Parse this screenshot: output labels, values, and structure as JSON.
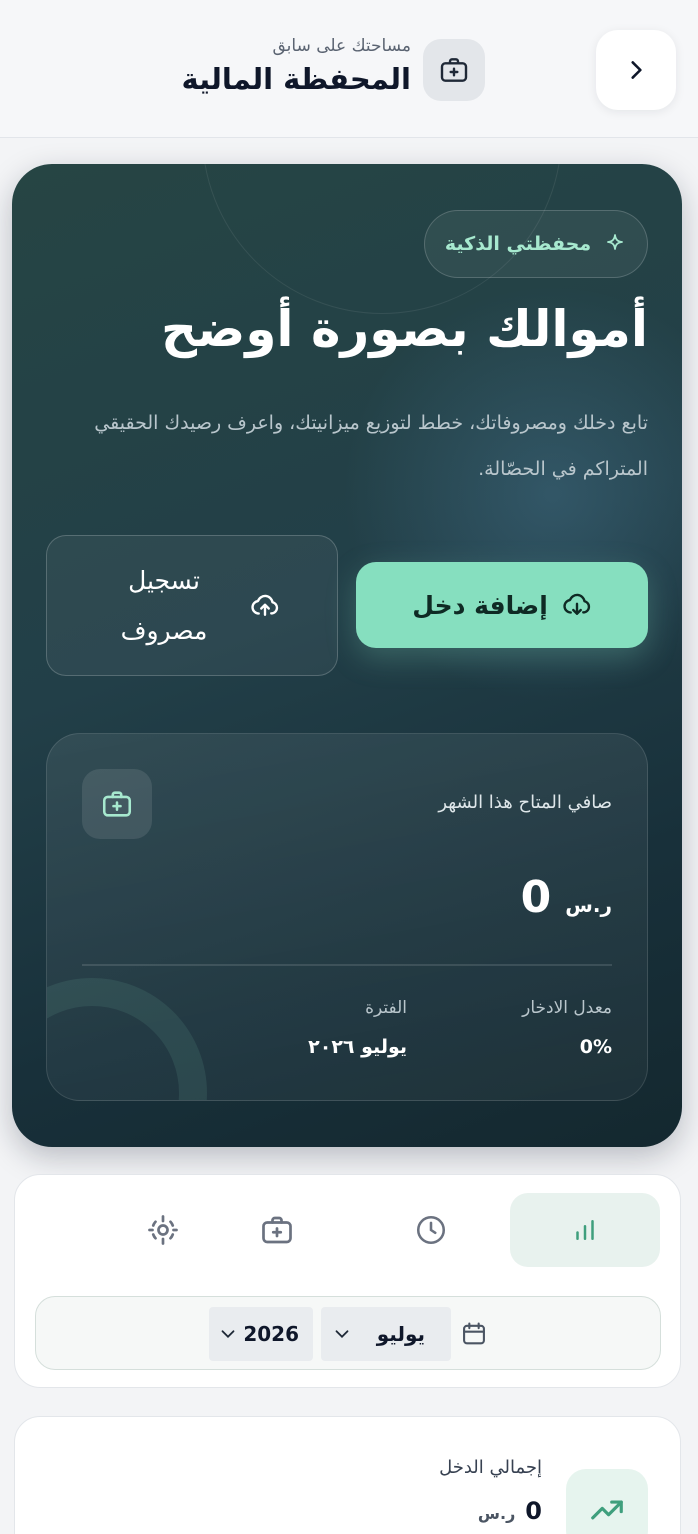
{
  "header": {
    "subtitle": "مساحتك على سابق",
    "title": "المحفظة المالية",
    "back_icon": "chevron-right-icon",
    "wallet_icon": "wallet-icon"
  },
  "hero": {
    "badge": "محفظتي الذكية",
    "title": "أموالك بصورة أوضح",
    "description": "تابع دخلك ومصروفاتك، خطط لتوزيع ميزانيتك، واعرف رصيدك الحقيقي المتراكم في الحصّالة.",
    "add_income_label": "إضافة دخل",
    "log_expense_label": "تسجيل مصروف",
    "net": {
      "label": "صافي المتاح هذا الشهر",
      "value": "0",
      "currency": "ر.س",
      "savings_rate_label": "معدل الادخار",
      "savings_rate_value": "0%",
      "period_label": "الفترة",
      "period_value": "يوليو ٢٠٢٦"
    }
  },
  "tabs": [
    {
      "name": "overview",
      "icon": "bar-chart-icon",
      "active": true
    },
    {
      "name": "history",
      "icon": "clock-icon",
      "active": false
    },
    {
      "name": "wallet",
      "icon": "wallet-icon",
      "active": false
    },
    {
      "name": "goals",
      "icon": "target-icon",
      "active": false
    }
  ],
  "period_filter": {
    "month": "يوليو",
    "year": "2026"
  },
  "summary": {
    "income_label": "إجمالي الدخل",
    "income_value": "0",
    "currency": "ر.س"
  },
  "colors": {
    "accent": "#86dfbf",
    "hero_dark": "#1b3438",
    "badge_text": "#a7e9cf"
  }
}
